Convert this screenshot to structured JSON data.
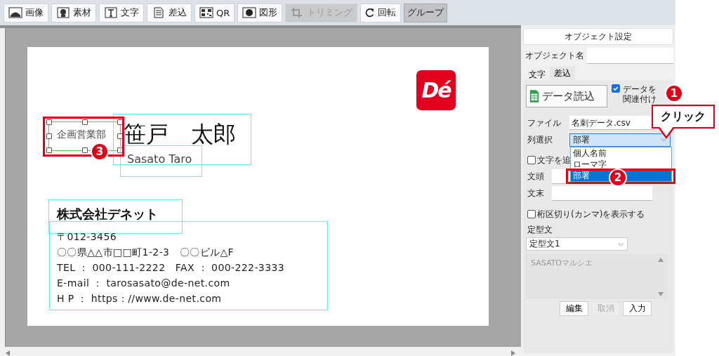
{
  "toolbar": [
    {
      "kind": "image",
      "label": "画像",
      "disabled": false,
      "pressed": false
    },
    {
      "kind": "material",
      "label": "素材",
      "disabled": false,
      "pressed": false
    },
    {
      "kind": "text",
      "label": "文字",
      "disabled": false,
      "pressed": false
    },
    {
      "kind": "merge",
      "label": "差込",
      "disabled": false,
      "pressed": false
    },
    {
      "kind": "qr",
      "label": "QR",
      "disabled": false,
      "pressed": false
    },
    {
      "kind": "shape",
      "label": "図形",
      "disabled": false,
      "pressed": false
    },
    {
      "kind": "trim",
      "label": "トリミング",
      "disabled": true,
      "pressed": false
    },
    {
      "kind": "rotate",
      "label": "回転",
      "disabled": false,
      "pressed": false
    },
    {
      "kind": "none",
      "label": "グループ",
      "disabled": false,
      "pressed": true
    }
  ],
  "card": {
    "logo_text": "Dé",
    "department": {
      "text": "企画営業部",
      "selected": true
    },
    "name": "笹戸　太郎",
    "romaji": "Sasato Taro",
    "company": "株式会社デネット",
    "address_lines": [
      "〒012-3456",
      "〇〇県△△市□□町1-2-3　〇〇ビル△F",
      "TEL ： 000-111-2222　FAX ： 000-222-3333",
      "E-mail ： tarosasato@de-net.com",
      "H P ： https：//www.de-net.com"
    ]
  },
  "panel": {
    "title": "オブジェクト設定",
    "object_name": {
      "label": "オブジェクト名"
    },
    "tabs": [
      {
        "label": "文字",
        "selected": false
      },
      {
        "label": "差込",
        "selected": true
      }
    ],
    "load_button": "データ読込",
    "link_checkbox": {
      "label": "データを関連付け",
      "checked": true
    },
    "file": {
      "label": "ファイル",
      "value": "名刺データ.csv"
    },
    "column": {
      "label": "列選択",
      "value": "部署",
      "options": [
        {
          "label": "個人名前",
          "selected": false
        },
        {
          "label": "ローマ字",
          "selected": false
        },
        {
          "label": "部署",
          "selected": true
        }
      ]
    },
    "add_text": {
      "label": "文字を追",
      "checked": false
    },
    "prefix": {
      "label": "文頭"
    },
    "suffix": {
      "label": "文末"
    },
    "comma": {
      "label": "桁区切り(カンマ)を表示する",
      "checked": false
    },
    "template": {
      "label": "定型文",
      "value": "定型文1",
      "text": "SASATOマルシエ"
    },
    "buttons": [
      {
        "label": "編集",
        "disabled": false
      },
      {
        "label": "取消",
        "disabled": true
      },
      {
        "label": "入力",
        "disabled": false
      }
    ]
  },
  "annotations": [
    {
      "number": "1",
      "text": "クリック"
    },
    {
      "number": "2"
    },
    {
      "number": "3"
    }
  ]
}
